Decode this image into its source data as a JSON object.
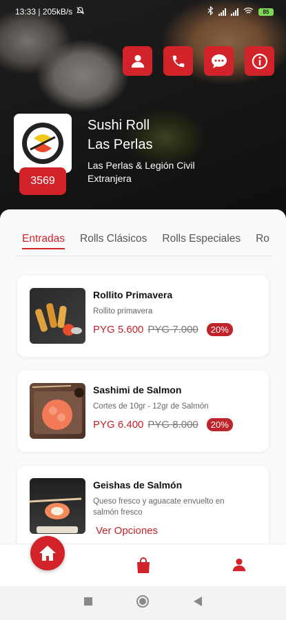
{
  "status_bar": {
    "time_info": "13:33 | 205kB/s",
    "battery": "85"
  },
  "store": {
    "name": "Sushi Roll\nLas Perlas",
    "address": "Las Perlas & Legión Civil Extranjera",
    "count": "3569"
  },
  "header_actions": [
    "user-icon",
    "phone-icon",
    "chat-icon",
    "info-icon"
  ],
  "tabs": [
    "Entradas",
    "Rolls Clásicos",
    "Rolls Especiales",
    "Ro"
  ],
  "products": [
    {
      "name": "Rollito Primavera",
      "description": "Rollito primavera",
      "price": "PYG 5.600",
      "old_price": "PYG 7.000",
      "discount": "20%"
    },
    {
      "name": "Sashimi de Salmon",
      "description": "Cortes de 10gr - 12gr de Salmón",
      "price": "PYG 6.400",
      "old_price": "PYG 8.000",
      "discount": "20%"
    },
    {
      "name": "Geishas de Salmón",
      "description": "Queso fresco y aguacate envuelto en salmón fresco",
      "options_label": "Ver Opciones"
    }
  ],
  "colors": {
    "accent": "#d2232a",
    "price": "#c0232a"
  }
}
